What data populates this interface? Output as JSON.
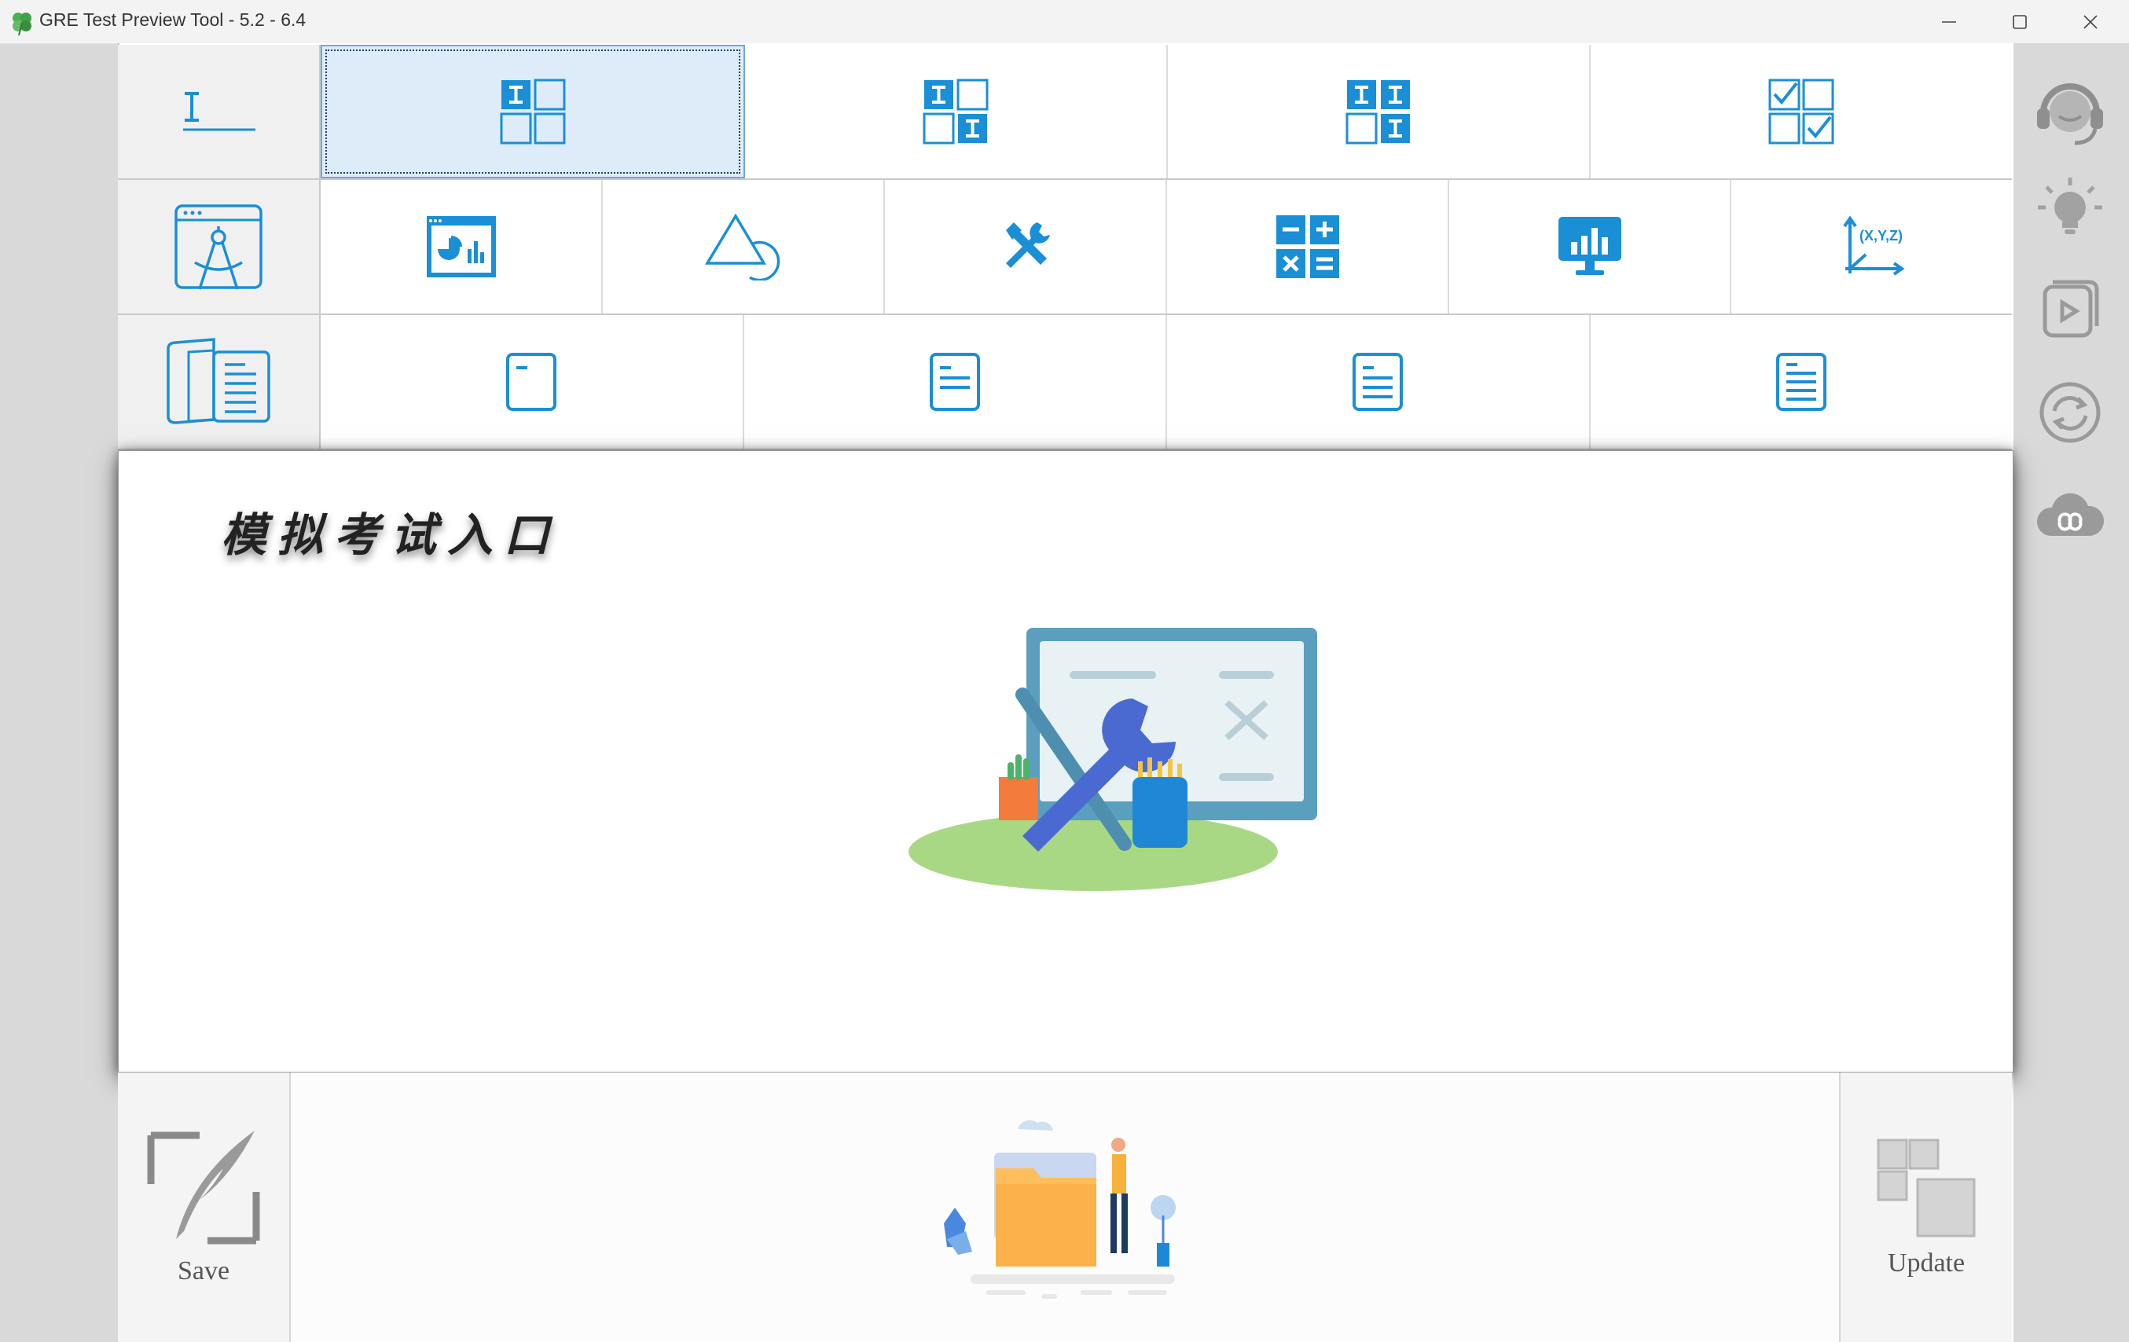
{
  "window": {
    "title": "GRE Test Preview Tool - 5.2 - 6.4",
    "controls": [
      "minimize",
      "maximize",
      "close"
    ]
  },
  "grid": {
    "row1": {
      "label_icon": "text-underline-icon",
      "cells": [
        "quant-grid-1-icon",
        "quant-grid-2-icon",
        "quant-grid-3-icon",
        "quant-grid-check-icon"
      ],
      "selected_index": 0
    },
    "row2": {
      "label_icon": "geometry-compass-icon",
      "cells": [
        "data-chart-icon",
        "shapes-icon",
        "tools-icon",
        "calculator-icon",
        "monitor-chart-icon",
        "xyz-axis-icon"
      ]
    },
    "row3": {
      "label_icon": "open-book-icon",
      "cells": [
        "document-1-icon",
        "document-2-icon",
        "document-3-icon",
        "document-4-icon"
      ]
    }
  },
  "sidebar": {
    "items": [
      "headset-icon",
      "lightbulb-icon",
      "video-play-icon",
      "refresh-icon",
      "cloud-icon"
    ]
  },
  "panel": {
    "title": "模拟考试入口",
    "illustration": "maintenance-illustration"
  },
  "bottom": {
    "save_label": "Save",
    "update_label": "Update",
    "center_illustration": "folder-illustration"
  },
  "colors": {
    "accent": "#1a8fd6",
    "selected_bg": "#deecf9",
    "sidebar_icon": "#9a9a9a"
  }
}
